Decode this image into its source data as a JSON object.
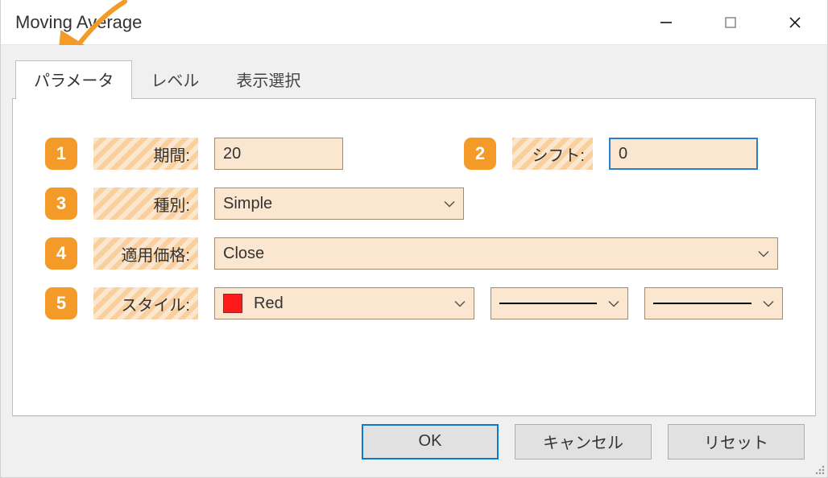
{
  "window": {
    "title": "Moving Average"
  },
  "tabs": {
    "t0": "パラメータ",
    "t1": "レベル",
    "t2": "表示選択"
  },
  "badge": {
    "b1": "1",
    "b2": "2",
    "b3": "3",
    "b4": "4",
    "b5": "5"
  },
  "labels": {
    "period": "期間:",
    "shift": "シフト:",
    "method": "種別:",
    "apply": "適用価格:",
    "style": "スタイル:"
  },
  "values": {
    "period": "20",
    "shift": "0",
    "method": "Simple",
    "apply": "Close",
    "style_color_name": "Red",
    "style_color_hex": "#ff1a1a"
  },
  "buttons": {
    "ok": "OK",
    "cancel": "キャンセル",
    "reset": "リセット"
  }
}
